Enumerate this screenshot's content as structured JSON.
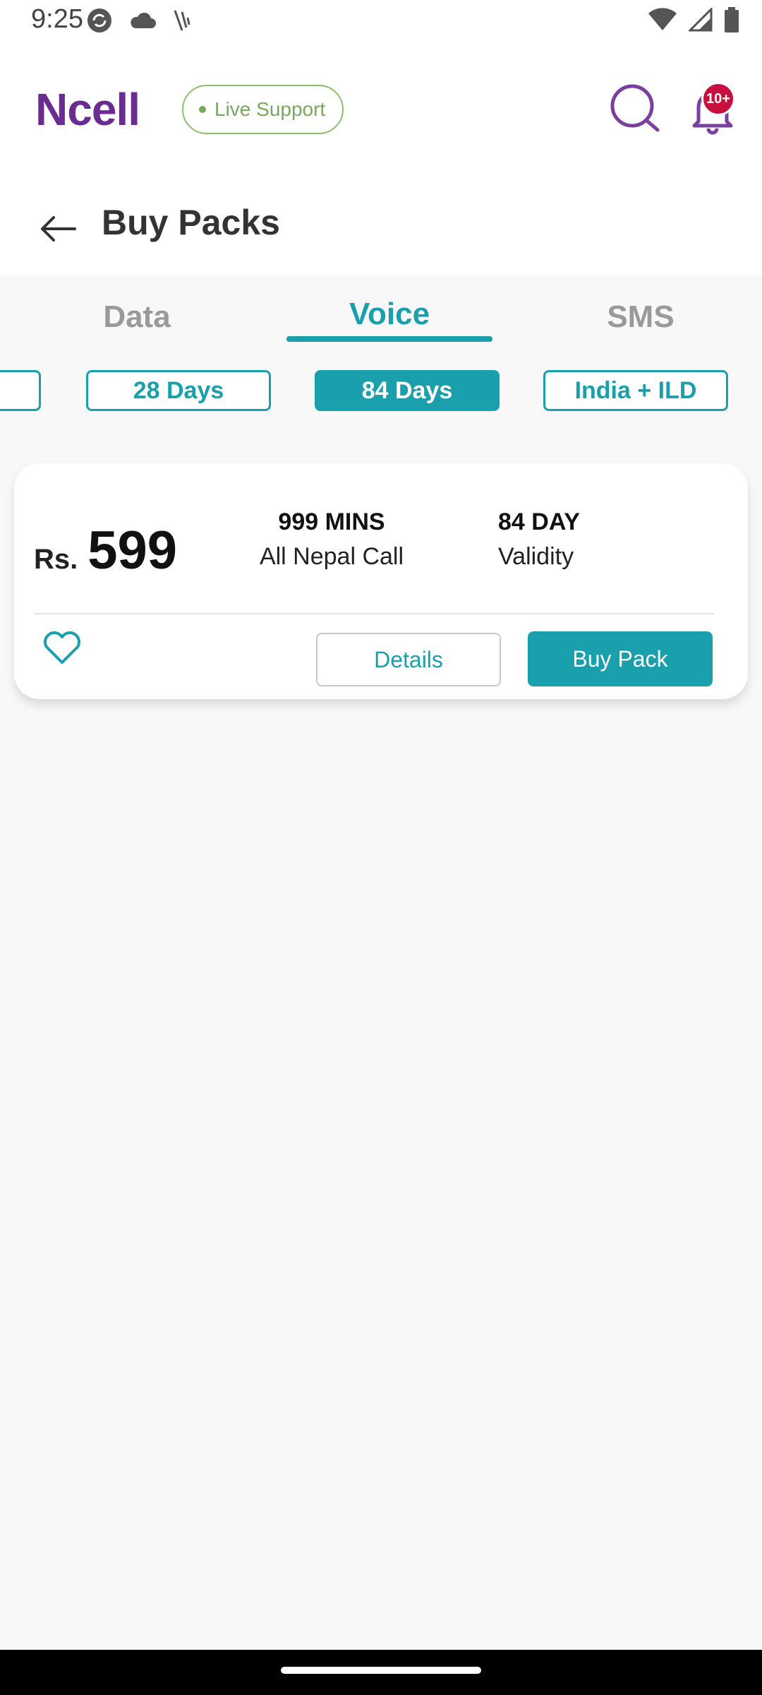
{
  "status_bar": {
    "time": "9:25",
    "left_icons": [
      "sync-icon",
      "cloud-icon",
      "signal-bolt-icon"
    ],
    "right_icons": [
      "wifi-icon",
      "cellular-icon",
      "battery-icon"
    ]
  },
  "header": {
    "logo": "Ncell",
    "live_support": "Live Support",
    "notification_count": "10+"
  },
  "page": {
    "title": "Buy Packs"
  },
  "tabs": [
    {
      "label": "Data",
      "active": false
    },
    {
      "label": "Voice",
      "active": true
    },
    {
      "label": "SMS",
      "active": false
    }
  ],
  "filters": [
    {
      "label": "28 Days",
      "active": false
    },
    {
      "label": "84 Days",
      "active": true
    },
    {
      "label": "India + ILD",
      "active": false
    }
  ],
  "pack": {
    "currency": "Rs.",
    "price": "599",
    "minutes_value": "999 MINS",
    "minutes_label": "All Nepal Call",
    "validity_value": "84 DAY",
    "validity_label": "Validity",
    "details_label": "Details",
    "buy_label": "Buy Pack"
  },
  "colors": {
    "brand": "#6a2c91",
    "accent": "#1a9fad",
    "live": "#76a95a",
    "badge": "#c8103e"
  }
}
